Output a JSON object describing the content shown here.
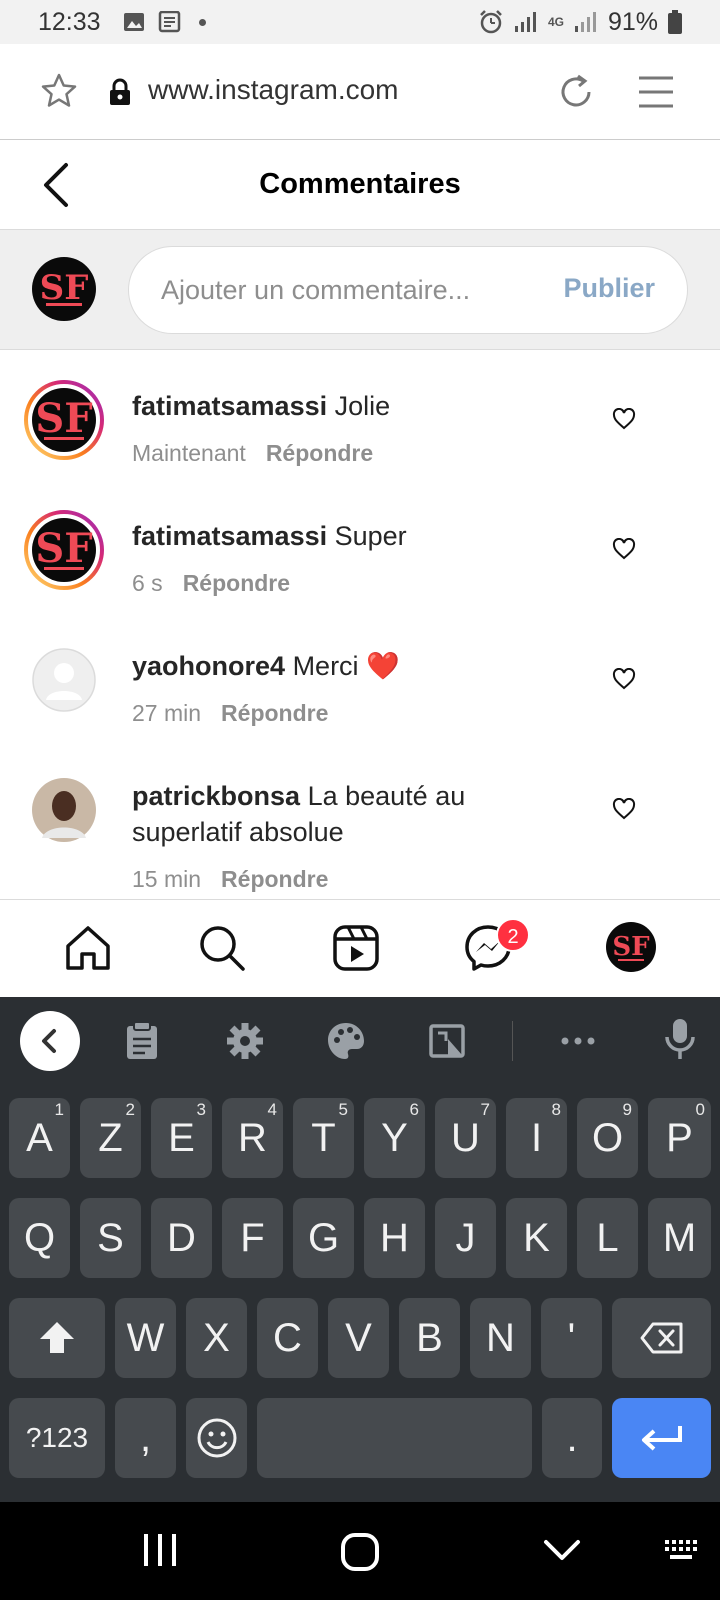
{
  "status": {
    "time": "12:33",
    "network": "4G",
    "battery": "91%"
  },
  "browser": {
    "url": "www.instagram.com",
    "icons": [
      "star-icon",
      "lock-icon",
      "reload-icon",
      "menu-icon"
    ]
  },
  "header": {
    "title": "Commentaires"
  },
  "composer": {
    "placeholder": "Ajouter un commentaire...",
    "publish_label": "Publier"
  },
  "comments": [
    {
      "user": "fatimatsamassi",
      "text": "Jolie",
      "time": "Maintenant",
      "reply": "Répondre"
    },
    {
      "user": "fatimatsamassi",
      "text": "Super",
      "time": "6 s",
      "reply": "Répondre"
    },
    {
      "user": "yaohonore4",
      "text": "Merci ❤️",
      "time": "27 min",
      "reply": "Répondre"
    },
    {
      "user": "patrickbonsa",
      "text": "La beauté au superlatif absolue",
      "time": "15 min",
      "reply": "Répondre"
    }
  ],
  "bottom_nav": {
    "messages_badge": "2",
    "items": [
      "home-icon",
      "search-icon",
      "reels-icon",
      "messenger-icon",
      "profile-avatar"
    ]
  },
  "keyboard": {
    "row1": [
      {
        "key": "A",
        "hint": "1"
      },
      {
        "key": "Z",
        "hint": "2"
      },
      {
        "key": "E",
        "hint": "3"
      },
      {
        "key": "R",
        "hint": "4"
      },
      {
        "key": "T",
        "hint": "5"
      },
      {
        "key": "Y",
        "hint": "6"
      },
      {
        "key": "U",
        "hint": "7"
      },
      {
        "key": "I",
        "hint": "8"
      },
      {
        "key": "O",
        "hint": "9"
      },
      {
        "key": "P",
        "hint": "0"
      }
    ],
    "row2": [
      "Q",
      "S",
      "D",
      "F",
      "G",
      "H",
      "J",
      "K",
      "L",
      "M"
    ],
    "row3": [
      "W",
      "X",
      "C",
      "V",
      "B",
      "N",
      "'"
    ],
    "symbols_label": "?123",
    "comma": ",",
    "period": "."
  }
}
